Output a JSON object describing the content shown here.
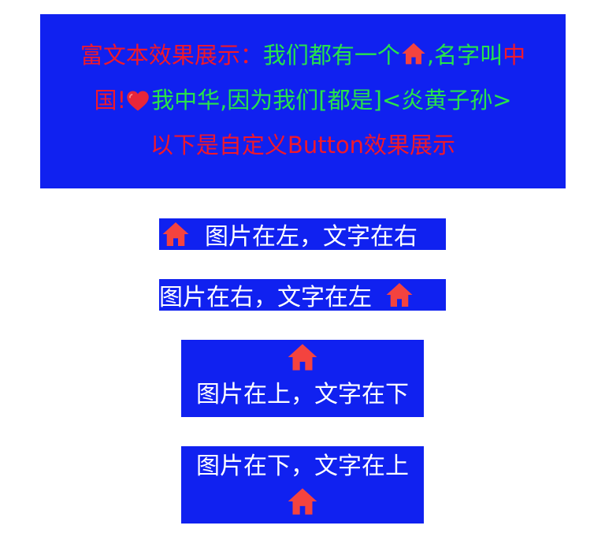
{
  "rich_text": {
    "line1_red": "富文本效果展示：",
    "line1_green": "我们都有一个",
    "line1_green2": ",名字叫",
    "line1_red2": "中",
    "line2_red": "国!",
    "line2_green": "我中华,因为我们[都是]<炎黄子孙>",
    "line3_red": "以下是自定义Button效果展示",
    "house_icon": "house-icon",
    "heart_icon": "heart-icon"
  },
  "buttons": {
    "image_left_text_right": "图片在左，文字在右",
    "image_right_text_left": "图片在右，文字在左",
    "image_top_text_bottom": "图片在上，文字在下",
    "image_bottom_text_top": "图片在下，文字在上"
  },
  "colors": {
    "background": "#1021f0",
    "red_text": "#f0182b",
    "green_text": "#27e34b",
    "white_text": "#ffffff",
    "icon_red": "#f4433f"
  }
}
